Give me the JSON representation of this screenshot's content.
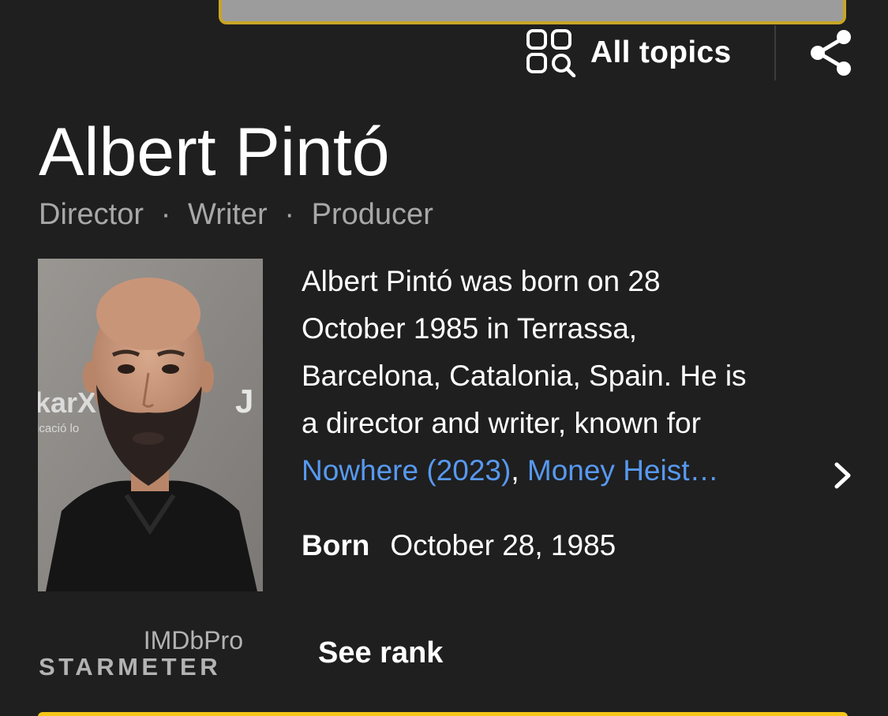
{
  "header": {
    "all_topics_label": "All topics",
    "all_topics_icon": "all-topics-icon",
    "share_icon": "share-icon"
  },
  "person": {
    "name": "Albert Pintó",
    "roles": [
      "Director",
      "Writer",
      "Producer"
    ],
    "role_separator": "·",
    "photo_alt": "Albert Pintó"
  },
  "bio": {
    "lines": [
      "Albert Pintó was born on 28",
      "October 1985 in Terrassa,",
      "Barcelona, Catalonia, Spain. He is",
      "a director and writer, known for"
    ],
    "link_1": "Nowhere (2023)",
    "link_separator": ", ",
    "link_2": "Money Heist…",
    "more_icon": "chevron-right-icon"
  },
  "born": {
    "label": "Born",
    "value": "October 28, 1985"
  },
  "starmeter": {
    "brand": "IMDbPro",
    "label": "STARMETER",
    "action_label": "See rank"
  },
  "colors": {
    "background": "#1f1f1f",
    "link": "#5799ef",
    "accent": "#f5c518",
    "secondary_text": "#a8a8a8"
  }
}
